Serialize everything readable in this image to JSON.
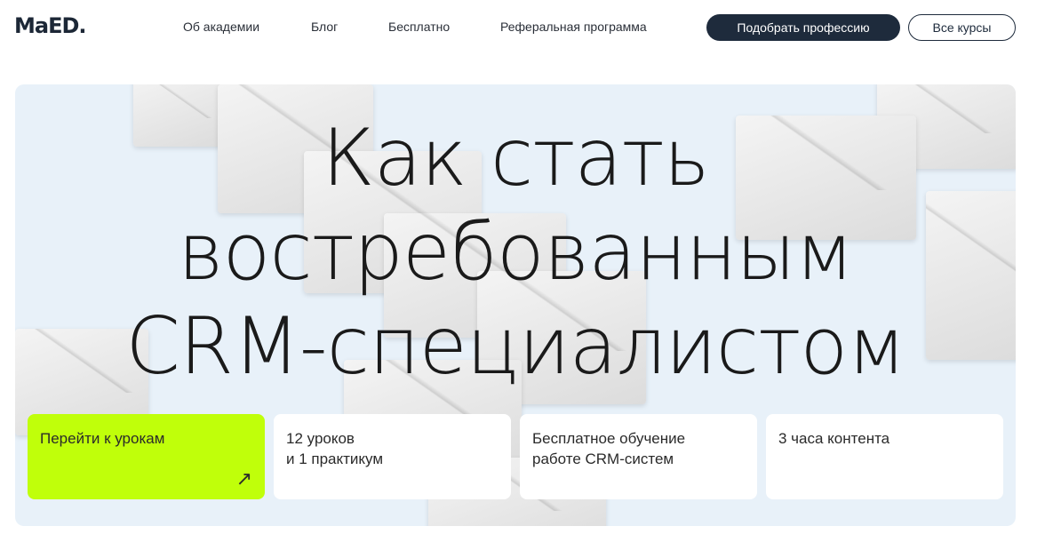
{
  "header": {
    "logo": "MaED.",
    "nav": [
      "Об академии",
      "Блог",
      "Бесплатно",
      "Реферальная программа"
    ],
    "primary_button": "Подобрать профессию",
    "secondary_button": "Все курсы"
  },
  "hero": {
    "title_lines": [
      "Как стать",
      "востребованным",
      "CRM-специалистом"
    ],
    "cards": [
      {
        "text": "Перейти к урокам"
      },
      {
        "line1": "12 уроков",
        "line2": "и 1 практикум"
      },
      {
        "line1": "Бесплатное обучение",
        "line2": "работе CRM-систем"
      },
      {
        "text": "3 часа контента"
      }
    ],
    "accent": "#c0ff0a"
  }
}
